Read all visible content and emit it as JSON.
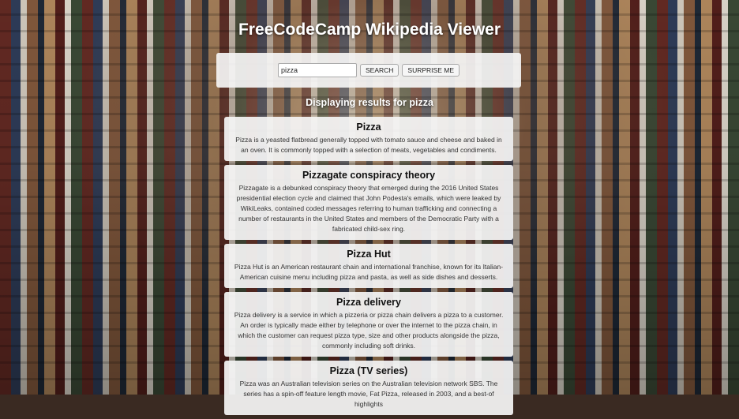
{
  "header": {
    "title": "FreeCodeCamp Wikipedia Viewer"
  },
  "search": {
    "value": "pizza",
    "search_label": "SEARCH",
    "surprise_label": "SURPRISE ME"
  },
  "results_heading": "Displaying results for pizza",
  "results": [
    {
      "title": "Pizza",
      "snippet": "Pizza is a yeasted flatbread generally topped with tomato sauce and cheese and baked in an oven. It is commonly topped with a selection of meats, vegetables and condiments."
    },
    {
      "title": "Pizzagate conspiracy theory",
      "snippet": "Pizzagate is a debunked conspiracy theory that emerged during the 2016 United States presidential election cycle and claimed that John Podesta's emails, which were leaked by WikiLeaks, contained coded messages referring to human trafficking and connecting a number of restaurants in the United States and members of the Democratic Party with a fabricated child-sex ring."
    },
    {
      "title": "Pizza Hut",
      "snippet": "Pizza Hut is an American restaurant chain and international franchise, known for its Italian-American cuisine menu including pizza and pasta, as well as side dishes and desserts."
    },
    {
      "title": "Pizza delivery",
      "snippet": "Pizza delivery is a service in which a pizzeria or pizza chain delivers a pizza to a customer. An order is typically made either by telephone or over the internet to the pizza chain, in which the customer can request pizza type, size and other products alongside the pizza, commonly including soft drinks."
    },
    {
      "title": "Pizza (TV series)",
      "snippet": "Pizza was an Australian television series on the Australian television network SBS. The series has a spin-off feature length movie, Fat Pizza, released in 2003, and a best-of highlights"
    }
  ]
}
